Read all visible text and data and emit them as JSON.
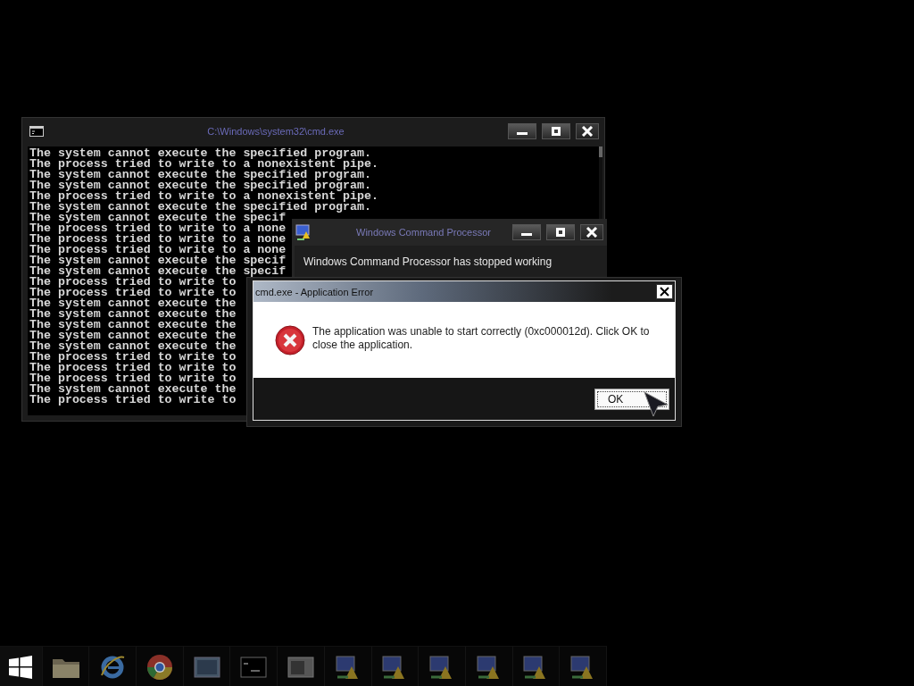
{
  "console_window": {
    "title": "C:\\Windows\\system32\\cmd.exe",
    "lines": [
      "The system cannot execute the specified program.",
      "The process tried to write to a nonexistent pipe.",
      "The system cannot execute the specified program.",
      "The system cannot execute the specified program.",
      "The process tried to write to a nonexistent pipe.",
      "The system cannot execute the specified program.",
      "The system cannot execute the specif",
      "The process tried to write to a none",
      "The process tried to write to a none",
      "The process tried to write to a none",
      "The system cannot execute the specif",
      "The system cannot execute the specif",
      "The process tried to write to",
      "The process tried to write to",
      "The system cannot execute the",
      "The system cannot execute the",
      "The system cannot execute the",
      "The system cannot execute the",
      "The system cannot execute the",
      "The process tried to write to",
      "The process tried to write to",
      "The process tried to write to",
      "The system cannot execute the",
      "The process tried to write to"
    ]
  },
  "crash_window": {
    "title": "Windows Command Processor",
    "message": "Windows Command Processor has stopped working"
  },
  "error_dialog": {
    "title": "cmd.exe - Application Error",
    "message": "The application was unable to start correctly (0xc000012d). Click OK to close the application.",
    "button": "OK"
  },
  "taskbar": {
    "items": [
      {
        "kind": "start"
      },
      {
        "kind": "folder"
      },
      {
        "kind": "ie"
      },
      {
        "kind": "chrome"
      },
      {
        "kind": "picture"
      },
      {
        "kind": "console"
      },
      {
        "kind": "window"
      },
      {
        "kind": "warning"
      },
      {
        "kind": "warning"
      },
      {
        "kind": "warning"
      },
      {
        "kind": "warning"
      },
      {
        "kind": "warning"
      },
      {
        "kind": "warning"
      }
    ]
  }
}
